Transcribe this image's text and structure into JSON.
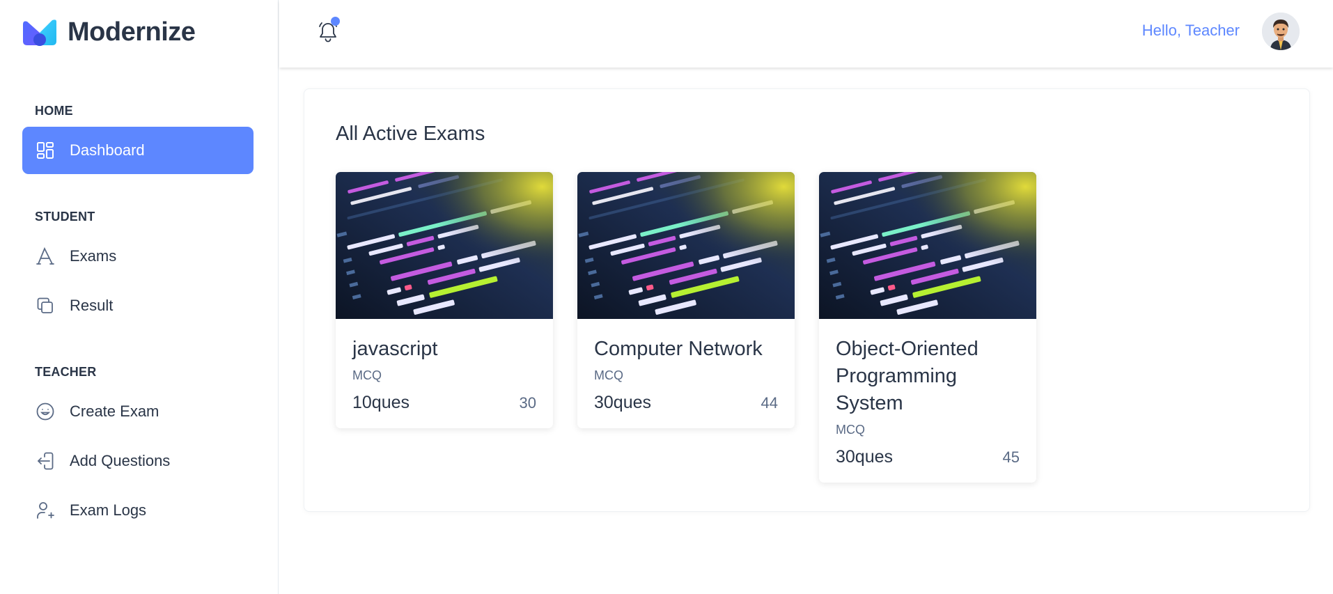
{
  "brand": {
    "name": "Modernize"
  },
  "sidebar": {
    "sections": [
      {
        "caption": "HOME"
      },
      {
        "caption": "STUDENT"
      },
      {
        "caption": "TEACHER"
      }
    ],
    "items": [
      {
        "label": "Dashboard",
        "icon": "dashboard-icon",
        "active": true
      },
      {
        "label": "Exams",
        "icon": "typography-icon"
      },
      {
        "label": "Result",
        "icon": "copy-icon"
      },
      {
        "label": "Create Exam",
        "icon": "mood-happy-icon"
      },
      {
        "label": "Add Questions",
        "icon": "login-icon"
      },
      {
        "label": "Exam Logs",
        "icon": "user-plus-icon"
      }
    ]
  },
  "header": {
    "greeting": "Hello, Teacher",
    "notification_icon": "bell-icon",
    "accent": "#5d87ff"
  },
  "main": {
    "title": "All Active Exams",
    "exams": [
      {
        "title": "javascript",
        "type": "MCQ",
        "questions": "10ques",
        "count": "30"
      },
      {
        "title": "Computer Network",
        "type": "MCQ",
        "questions": "30ques",
        "count": "44"
      },
      {
        "title": "Object-Oriented Programming System",
        "type": "MCQ",
        "questions": "30ques",
        "count": "45"
      }
    ]
  }
}
